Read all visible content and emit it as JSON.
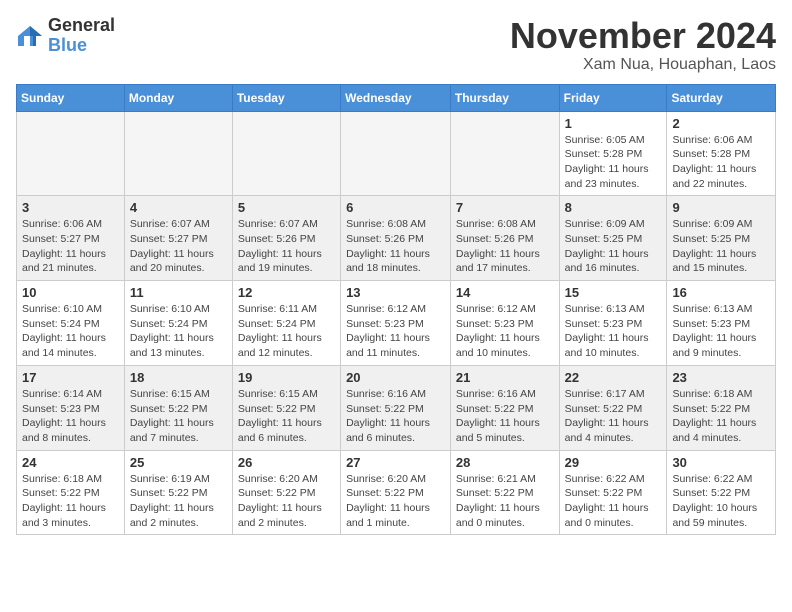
{
  "logo": {
    "general": "General",
    "blue": "Blue"
  },
  "title": "November 2024",
  "subtitle": "Xam Nua, Houaphan, Laos",
  "headers": [
    "Sunday",
    "Monday",
    "Tuesday",
    "Wednesday",
    "Thursday",
    "Friday",
    "Saturday"
  ],
  "weeks": [
    [
      {
        "day": "",
        "info": "",
        "empty": true
      },
      {
        "day": "",
        "info": "",
        "empty": true
      },
      {
        "day": "",
        "info": "",
        "empty": true
      },
      {
        "day": "",
        "info": "",
        "empty": true
      },
      {
        "day": "",
        "info": "",
        "empty": true
      },
      {
        "day": "1",
        "info": "Sunrise: 6:05 AM\nSunset: 5:28 PM\nDaylight: 11 hours and 23 minutes.",
        "empty": false
      },
      {
        "day": "2",
        "info": "Sunrise: 6:06 AM\nSunset: 5:28 PM\nDaylight: 11 hours and 22 minutes.",
        "empty": false
      }
    ],
    [
      {
        "day": "3",
        "info": "Sunrise: 6:06 AM\nSunset: 5:27 PM\nDaylight: 11 hours and 21 minutes.",
        "empty": false,
        "shaded": true
      },
      {
        "day": "4",
        "info": "Sunrise: 6:07 AM\nSunset: 5:27 PM\nDaylight: 11 hours and 20 minutes.",
        "empty": false,
        "shaded": true
      },
      {
        "day": "5",
        "info": "Sunrise: 6:07 AM\nSunset: 5:26 PM\nDaylight: 11 hours and 19 minutes.",
        "empty": false,
        "shaded": true
      },
      {
        "day": "6",
        "info": "Sunrise: 6:08 AM\nSunset: 5:26 PM\nDaylight: 11 hours and 18 minutes.",
        "empty": false,
        "shaded": true
      },
      {
        "day": "7",
        "info": "Sunrise: 6:08 AM\nSunset: 5:26 PM\nDaylight: 11 hours and 17 minutes.",
        "empty": false,
        "shaded": true
      },
      {
        "day": "8",
        "info": "Sunrise: 6:09 AM\nSunset: 5:25 PM\nDaylight: 11 hours and 16 minutes.",
        "empty": false,
        "shaded": true
      },
      {
        "day": "9",
        "info": "Sunrise: 6:09 AM\nSunset: 5:25 PM\nDaylight: 11 hours and 15 minutes.",
        "empty": false,
        "shaded": true
      }
    ],
    [
      {
        "day": "10",
        "info": "Sunrise: 6:10 AM\nSunset: 5:24 PM\nDaylight: 11 hours and 14 minutes.",
        "empty": false
      },
      {
        "day": "11",
        "info": "Sunrise: 6:10 AM\nSunset: 5:24 PM\nDaylight: 11 hours and 13 minutes.",
        "empty": false
      },
      {
        "day": "12",
        "info": "Sunrise: 6:11 AM\nSunset: 5:24 PM\nDaylight: 11 hours and 12 minutes.",
        "empty": false
      },
      {
        "day": "13",
        "info": "Sunrise: 6:12 AM\nSunset: 5:23 PM\nDaylight: 11 hours and 11 minutes.",
        "empty": false
      },
      {
        "day": "14",
        "info": "Sunrise: 6:12 AM\nSunset: 5:23 PM\nDaylight: 11 hours and 10 minutes.",
        "empty": false
      },
      {
        "day": "15",
        "info": "Sunrise: 6:13 AM\nSunset: 5:23 PM\nDaylight: 11 hours and 10 minutes.",
        "empty": false
      },
      {
        "day": "16",
        "info": "Sunrise: 6:13 AM\nSunset: 5:23 PM\nDaylight: 11 hours and 9 minutes.",
        "empty": false
      }
    ],
    [
      {
        "day": "17",
        "info": "Sunrise: 6:14 AM\nSunset: 5:23 PM\nDaylight: 11 hours and 8 minutes.",
        "empty": false,
        "shaded": true
      },
      {
        "day": "18",
        "info": "Sunrise: 6:15 AM\nSunset: 5:22 PM\nDaylight: 11 hours and 7 minutes.",
        "empty": false,
        "shaded": true
      },
      {
        "day": "19",
        "info": "Sunrise: 6:15 AM\nSunset: 5:22 PM\nDaylight: 11 hours and 6 minutes.",
        "empty": false,
        "shaded": true
      },
      {
        "day": "20",
        "info": "Sunrise: 6:16 AM\nSunset: 5:22 PM\nDaylight: 11 hours and 6 minutes.",
        "empty": false,
        "shaded": true
      },
      {
        "day": "21",
        "info": "Sunrise: 6:16 AM\nSunset: 5:22 PM\nDaylight: 11 hours and 5 minutes.",
        "empty": false,
        "shaded": true
      },
      {
        "day": "22",
        "info": "Sunrise: 6:17 AM\nSunset: 5:22 PM\nDaylight: 11 hours and 4 minutes.",
        "empty": false,
        "shaded": true
      },
      {
        "day": "23",
        "info": "Sunrise: 6:18 AM\nSunset: 5:22 PM\nDaylight: 11 hours and 4 minutes.",
        "empty": false,
        "shaded": true
      }
    ],
    [
      {
        "day": "24",
        "info": "Sunrise: 6:18 AM\nSunset: 5:22 PM\nDaylight: 11 hours and 3 minutes.",
        "empty": false
      },
      {
        "day": "25",
        "info": "Sunrise: 6:19 AM\nSunset: 5:22 PM\nDaylight: 11 hours and 2 minutes.",
        "empty": false
      },
      {
        "day": "26",
        "info": "Sunrise: 6:20 AM\nSunset: 5:22 PM\nDaylight: 11 hours and 2 minutes.",
        "empty": false
      },
      {
        "day": "27",
        "info": "Sunrise: 6:20 AM\nSunset: 5:22 PM\nDaylight: 11 hours and 1 minute.",
        "empty": false
      },
      {
        "day": "28",
        "info": "Sunrise: 6:21 AM\nSunset: 5:22 PM\nDaylight: 11 hours and 0 minutes.",
        "empty": false
      },
      {
        "day": "29",
        "info": "Sunrise: 6:22 AM\nSunset: 5:22 PM\nDaylight: 11 hours and 0 minutes.",
        "empty": false
      },
      {
        "day": "30",
        "info": "Sunrise: 6:22 AM\nSunset: 5:22 PM\nDaylight: 10 hours and 59 minutes.",
        "empty": false
      }
    ]
  ]
}
